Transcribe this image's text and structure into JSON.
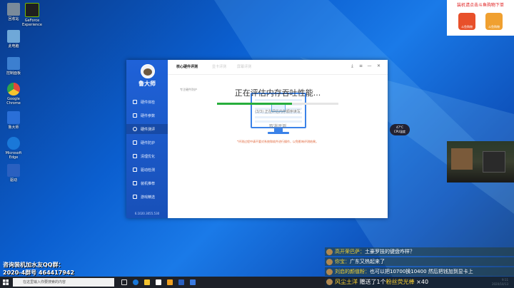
{
  "desktop": {
    "icons": [
      {
        "label": "回收站",
        "color": "#7a8a9a"
      },
      {
        "label": "GeForce Experience",
        "color": "#1f1f1f"
      },
      {
        "label": "此电脑",
        "color": "#6fa8d8"
      },
      {
        "label": "控制面板",
        "color": "#3c7fd0"
      },
      {
        "label": "Google Chrome",
        "color": "#e04a3a"
      },
      {
        "label": "鲁大师",
        "color": "#2a6fd8"
      },
      {
        "label": "Microsoft Edge",
        "color": "#1a78d8"
      },
      {
        "label": "驱动",
        "color": "#2a60c0"
      }
    ]
  },
  "app": {
    "name": "鲁大师",
    "slogan": "专注硬件防护",
    "version": "6.1020.3055.530",
    "nav": [
      {
        "label": "硬件体检",
        "active": false
      },
      {
        "label": "硬件参数",
        "active": false
      },
      {
        "label": "硬件测评",
        "active": true
      },
      {
        "label": "硬件防护",
        "active": false
      },
      {
        "label": "清理优化",
        "active": false
      },
      {
        "label": "驱动检测",
        "active": false
      },
      {
        "label": "装机推荐",
        "active": false
      },
      {
        "label": "游戏精选",
        "active": false
      }
    ],
    "tabs": {
      "main": "核心硬件评测",
      "g1": "显卡评测",
      "g2": "屏幕评测"
    },
    "window_controls": {
      "download": "⤓",
      "menu": "≡",
      "minimize": "—",
      "close": "✕"
    },
    "status_title": "正在评估内存吞吐性能...",
    "progress": 0.62,
    "progress_color": "#27ae3c",
    "step_text": "(3/3) 正在评估内存顺序读写",
    "cancel_label": "取消评测",
    "warning": "*评测过程中请不要对系统和软件进行操作，以免影响评测结果。"
  },
  "promo": {
    "title": "装机请点击斗鱼购物下单",
    "left_label": "斗鱼购物",
    "right_label": "斗鱼购物"
  },
  "cpu_widget": {
    "temp": "47°C",
    "label": "CPU温度"
  },
  "qq_group": {
    "line1": "咨询装机加水友QQ群：",
    "line2": "2020-4群号 464417942"
  },
  "danmaku": [
    {
      "user": "高开荣巴萨：",
      "text": "土豪罗技的键盘咋样？"
    },
    {
      "user": "你宝：",
      "text": "广东又热起来了"
    },
    {
      "user": "刘启的颜值粉：",
      "text": "也可以把10700换10400 然后把钱加到显卡上"
    }
  ],
  "gift": {
    "user": "风尘土洋",
    "mid": " 赠送了",
    "count": "1个",
    "item": "粉丝荧光棒",
    "combo": " ×40"
  },
  "taskbar": {
    "search_placeholder": "在这里输入你要搜索的内容",
    "time": "9:11",
    "date": "2020/10/13"
  }
}
